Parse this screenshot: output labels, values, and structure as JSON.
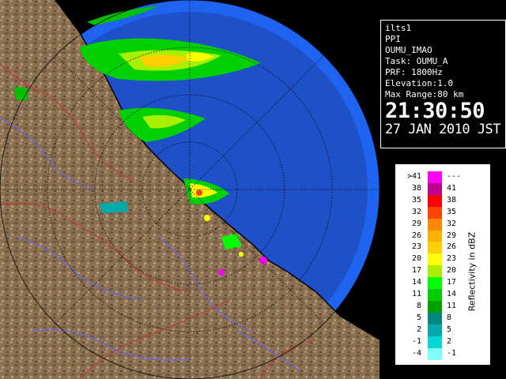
{
  "info": {
    "site": "ilts1",
    "product": "PPI",
    "station": "OUMU_IMAO",
    "task": "Task: OUMU_A",
    "prf": "PRF: 1800Hz",
    "elevation": "Elevation:1.0",
    "max_range": "Max Range:80 km",
    "time": "21:30:50",
    "date": "27 JAN 2010 JST"
  },
  "legend": {
    "title": "Reflectivity in dBZ",
    "rows": [
      {
        "low": ">41",
        "high": "---",
        "color": "#ff00ff"
      },
      {
        "low": "38",
        "high": "41",
        "color": "#c00090"
      },
      {
        "low": "35",
        "high": "38",
        "color": "#ff0000"
      },
      {
        "low": "32",
        "high": "35",
        "color": "#ff4400"
      },
      {
        "low": "29",
        "high": "32",
        "color": "#ff8800"
      },
      {
        "low": "26",
        "high": "29",
        "color": "#ffb000"
      },
      {
        "low": "23",
        "high": "26",
        "color": "#ffd000"
      },
      {
        "low": "20",
        "high": "23",
        "color": "#ffff00"
      },
      {
        "low": "17",
        "high": "20",
        "color": "#a8f000"
      },
      {
        "low": "14",
        "high": "17",
        "color": "#00ff00"
      },
      {
        "low": "11",
        "high": "14",
        "color": "#00cc00"
      },
      {
        "low": "8",
        "high": "11",
        "color": "#00a000"
      },
      {
        "low": "5",
        "high": "8",
        "color": "#008880"
      },
      {
        "low": "2",
        "high": "5",
        "color": "#00aaaa"
      },
      {
        "low": "-1",
        "high": "2",
        "color": "#00d8d8"
      },
      {
        "low": "-4",
        "high": "-1",
        "color": "#80ffff"
      }
    ]
  },
  "colors": {
    "sea_far": "#1e64f0",
    "sea_near": "#1e50c8",
    "land": "#8a7050",
    "coast": "#000000",
    "rivers": "#6464ff",
    "borders": "#c83232",
    "range_rings": "#000000"
  }
}
